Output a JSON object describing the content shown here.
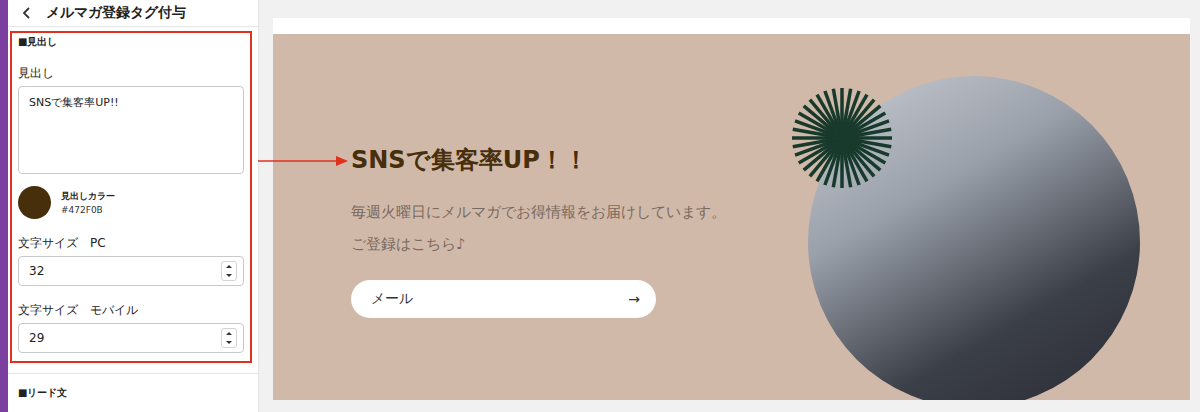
{
  "sidebar": {
    "title": "メルマガ登録タグ付与",
    "heading_section": {
      "section_title": "■見出し",
      "heading_label": "見出し",
      "heading_value": "SNSで集客率UP!!",
      "color_label": "見出しカラー",
      "color_value": "#472F0B",
      "color": "#472F0B",
      "pc_size_label": "文字サイズ　PC",
      "pc_size": "32",
      "mobile_size_label": "文字サイズ　モバイル",
      "mobile_size": "29"
    },
    "next_section": "■リード文"
  },
  "preview": {
    "heading": "SNSで集客率UP！！",
    "lead_lines": [
      "毎週火曜日にメルマガでお得情報をお届けしています。",
      "ご登録はこちら♪"
    ],
    "email_placeholder": "メール",
    "submit_icon": "→"
  }
}
